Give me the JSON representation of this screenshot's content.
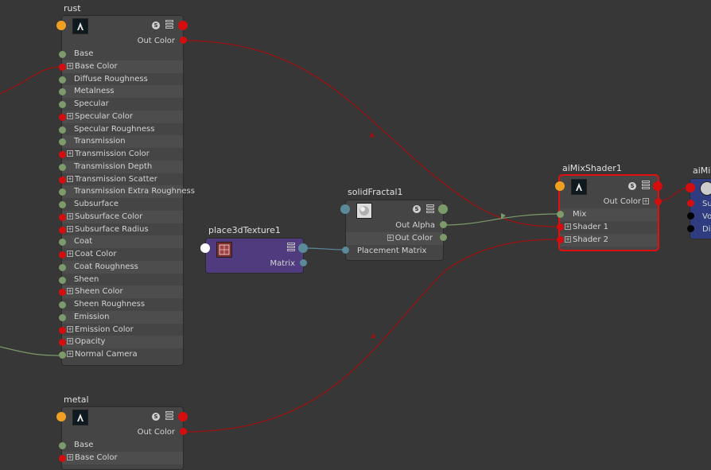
{
  "rust": {
    "title": "rust",
    "out_color": "Out Color",
    "attrs": [
      {
        "label": "Base",
        "plug": "g",
        "exp": false
      },
      {
        "label": "Base Color",
        "plug": "r",
        "exp": true
      },
      {
        "label": "Diffuse Roughness",
        "plug": "g",
        "exp": false
      },
      {
        "label": "Metalness",
        "plug": "g",
        "exp": false
      },
      {
        "label": "Specular",
        "plug": "g",
        "exp": false
      },
      {
        "label": "Specular Color",
        "plug": "r",
        "exp": true
      },
      {
        "label": "Specular Roughness",
        "plug": "g",
        "exp": false
      },
      {
        "label": "Transmission",
        "plug": "g",
        "exp": false
      },
      {
        "label": "Transmission Color",
        "plug": "r",
        "exp": true
      },
      {
        "label": "Transmission Depth",
        "plug": "g",
        "exp": false
      },
      {
        "label": "Transmission Scatter",
        "plug": "r",
        "exp": true
      },
      {
        "label": "Transmission Extra Roughness",
        "plug": "g",
        "exp": false
      },
      {
        "label": "Subsurface",
        "plug": "g",
        "exp": false
      },
      {
        "label": "Subsurface Color",
        "plug": "r",
        "exp": true
      },
      {
        "label": "Subsurface Radius",
        "plug": "r",
        "exp": true
      },
      {
        "label": "Coat",
        "plug": "g",
        "exp": false
      },
      {
        "label": "Coat Color",
        "plug": "r",
        "exp": true
      },
      {
        "label": "Coat Roughness",
        "plug": "g",
        "exp": false
      },
      {
        "label": "Sheen",
        "plug": "g",
        "exp": false
      },
      {
        "label": "Sheen Color",
        "plug": "r",
        "exp": true
      },
      {
        "label": "Sheen Roughness",
        "plug": "g",
        "exp": false
      },
      {
        "label": "Emission",
        "plug": "g",
        "exp": false
      },
      {
        "label": "Emission Color",
        "plug": "r",
        "exp": true
      },
      {
        "label": "Opacity",
        "plug": "r",
        "exp": true
      },
      {
        "label": "Normal Camera",
        "plug": "g",
        "exp": true
      }
    ]
  },
  "metal": {
    "title": "metal",
    "out_color": "Out Color",
    "attrs": [
      {
        "label": "Base",
        "plug": "g",
        "exp": false
      },
      {
        "label": "Base Color",
        "plug": "r",
        "exp": true
      }
    ]
  },
  "place3d": {
    "title": "place3dTexture1",
    "matrix": "Matrix"
  },
  "fractal": {
    "title": "solidFractal1",
    "out_alpha": "Out Alpha",
    "out_color": "Out Color",
    "placement": "Placement Matrix"
  },
  "mix": {
    "title": "aiMixShader1",
    "out_color": "Out Color",
    "mix": "Mix",
    "shader1": "Shader 1",
    "shader2": "Shader 2"
  },
  "sg": {
    "title": "aiMi",
    "rows": [
      "Su",
      "Vo",
      "Dis"
    ]
  },
  "badge": "S",
  "expand_glyph": "+",
  "colors": {
    "bg": "#373737",
    "node": "#454545",
    "red_wire": "#a01010",
    "green_wire": "#7c9a6a",
    "place3d": "#4f3b7e",
    "sg": "#2f3d80",
    "selected": "#e01010"
  }
}
